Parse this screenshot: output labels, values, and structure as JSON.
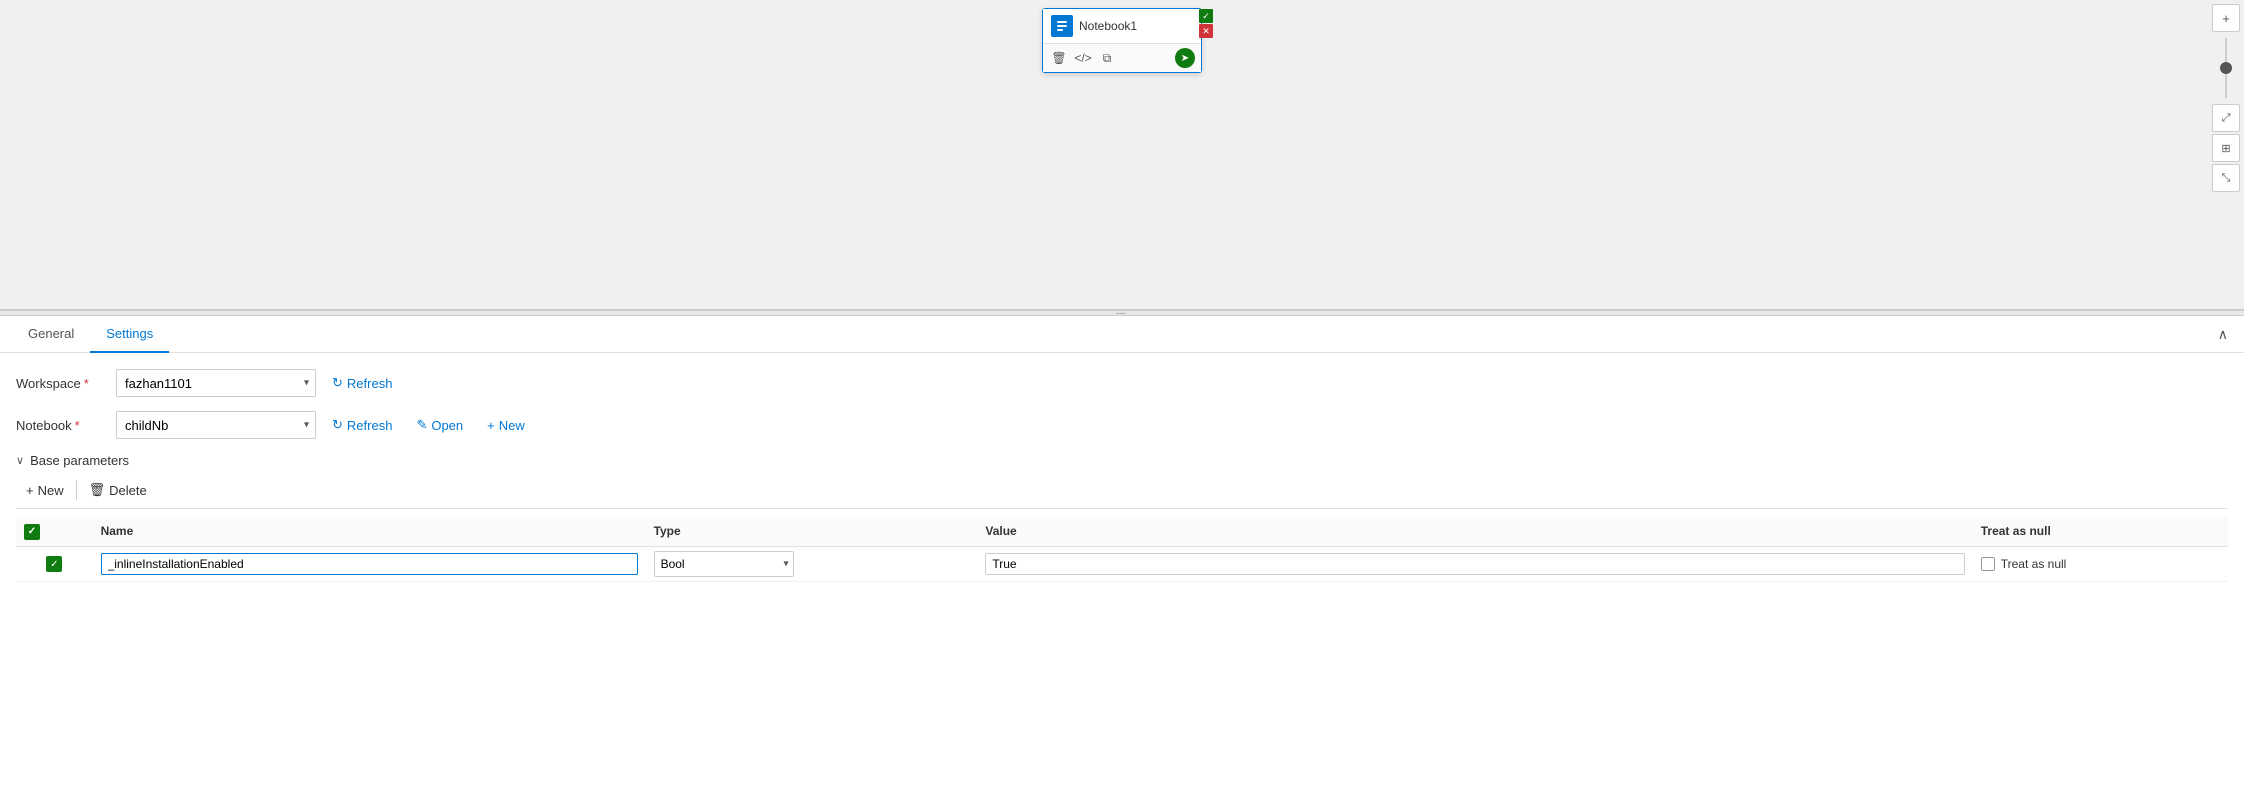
{
  "canvas": {
    "notebook_node": {
      "title": "Notebook1",
      "icon_text": "N"
    }
  },
  "tabs": [
    {
      "id": "general",
      "label": "General",
      "active": false
    },
    {
      "id": "settings",
      "label": "Settings",
      "active": true
    }
  ],
  "settings": {
    "workspace_label": "Workspace",
    "workspace_required": "*",
    "workspace_value": "fazhan1101",
    "workspace_refresh_label": "Refresh",
    "notebook_label": "Notebook",
    "notebook_required": "*",
    "notebook_value": "childNb",
    "notebook_refresh_label": "Refresh",
    "notebook_open_label": "Open",
    "notebook_new_label": "New",
    "base_params_label": "Base parameters",
    "toolbar": {
      "new_label": "New",
      "delete_label": "Delete"
    },
    "table": {
      "headers": [
        "Name",
        "Type",
        "Value",
        "Treat as null"
      ],
      "rows": [
        {
          "checked": true,
          "name": "_inlineInstallationEnabled",
          "type": "Bool",
          "value": "True",
          "treat_as_null": false
        }
      ]
    }
  },
  "right_controls": {
    "plus_label": "+",
    "fit_label": "⤢",
    "grid_label": "⊞",
    "shrink_label": "⤡"
  }
}
